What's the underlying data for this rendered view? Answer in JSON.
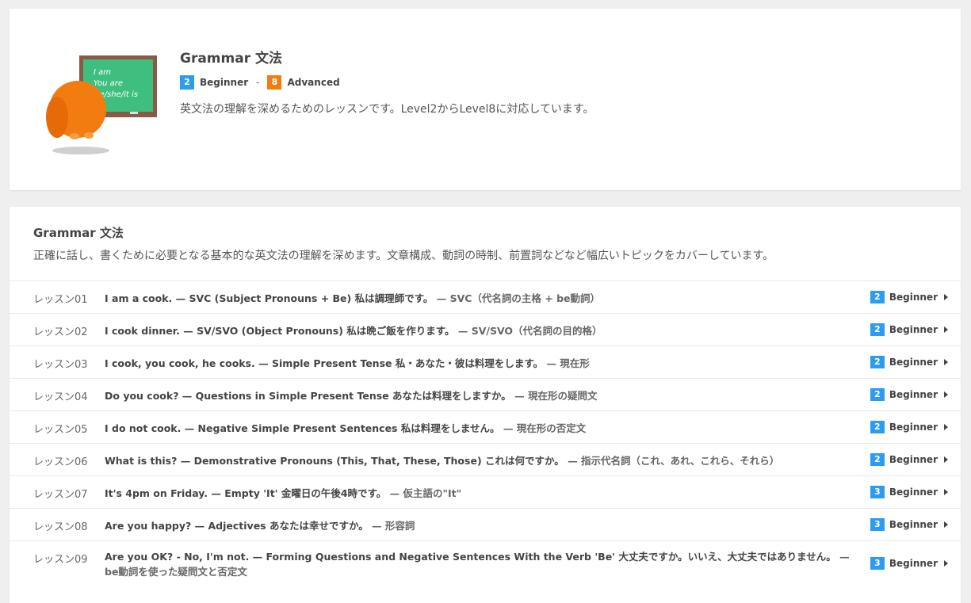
{
  "course": {
    "title": "Grammar 文法",
    "level_min": "2",
    "level_min_label": "Beginner",
    "separator": "-",
    "level_max": "8",
    "level_max_label": "Advanced",
    "description": "英文法の理解を深めるためのレッスンです。Level2からLevel8に対応しています。",
    "illustration_text": [
      "I am",
      "You are",
      "He/she/it is"
    ]
  },
  "section": {
    "title": "Grammar 文法",
    "description": "正確に話し、書くために必要となる基本的な英文法の理解を深めます。文章構成、動詞の時制、前置詞などなど幅広いトピックをカバーしています。"
  },
  "lessons": [
    {
      "num": "レッスン01",
      "title": "I am a cook. — SVC (Subject Pronouns + Be) 私は調理師です。",
      "sub": " — SVC（代名詞の主格 + be動詞）",
      "level": "2",
      "level_label": "Beginner"
    },
    {
      "num": "レッスン02",
      "title": "I cook dinner. — SV/SVO (Object Pronouns) 私は晩ご飯を作ります。",
      "sub": " — SV/SVO（代名詞の目的格）",
      "level": "2",
      "level_label": "Beginner"
    },
    {
      "num": "レッスン03",
      "title": "I cook, you cook, he cooks. — Simple Present Tense 私・あなた・彼は料理をします。",
      "sub": " — 現在形",
      "level": "2",
      "level_label": "Beginner"
    },
    {
      "num": "レッスン04",
      "title": "Do you cook? — Questions in Simple Present Tense あなたは料理をしますか。",
      "sub": " — 現在形の疑問文",
      "level": "2",
      "level_label": "Beginner"
    },
    {
      "num": "レッスン05",
      "title": "I do not cook. — Negative Simple Present Sentences 私は料理をしません。",
      "sub": " — 現在形の否定文",
      "level": "2",
      "level_label": "Beginner"
    },
    {
      "num": "レッスン06",
      "title": "What is this? — Demonstrative Pronouns (This, That, These, Those) これは何ですか。",
      "sub": " — 指示代名詞（これ、あれ、これら、それら）",
      "level": "2",
      "level_label": "Beginner"
    },
    {
      "num": "レッスン07",
      "title": "It's 4pm on Friday. — Empty 'It' 金曜日の午後4時です。",
      "sub": " — 仮主語の\"It\"",
      "level": "3",
      "level_label": "Beginner"
    },
    {
      "num": "レッスン08",
      "title": "Are you happy? — Adjectives あなたは幸せですか。",
      "sub": " — 形容詞",
      "level": "3",
      "level_label": "Beginner"
    },
    {
      "num": "レッスン09",
      "title": "Are you OK? - No, I'm not. — Forming Questions and Negative Sentences With the Verb 'Be' 大丈夫ですか。いいえ、大丈夫ではありません。",
      "sub": " — be動詞を使った疑問文と否定文",
      "level": "3",
      "level_label": "Beginner"
    }
  ],
  "colors": {
    "level_badge": "#2d9cf0",
    "advanced_badge": "#f27c10",
    "owl": "#f27c10",
    "chalkboard": "#3fbf7f",
    "chalkboard_frame": "#8a5a44"
  },
  "icons": [
    "owl-illustration",
    "chalkboard-illustration",
    "chevron-right-icon"
  ]
}
